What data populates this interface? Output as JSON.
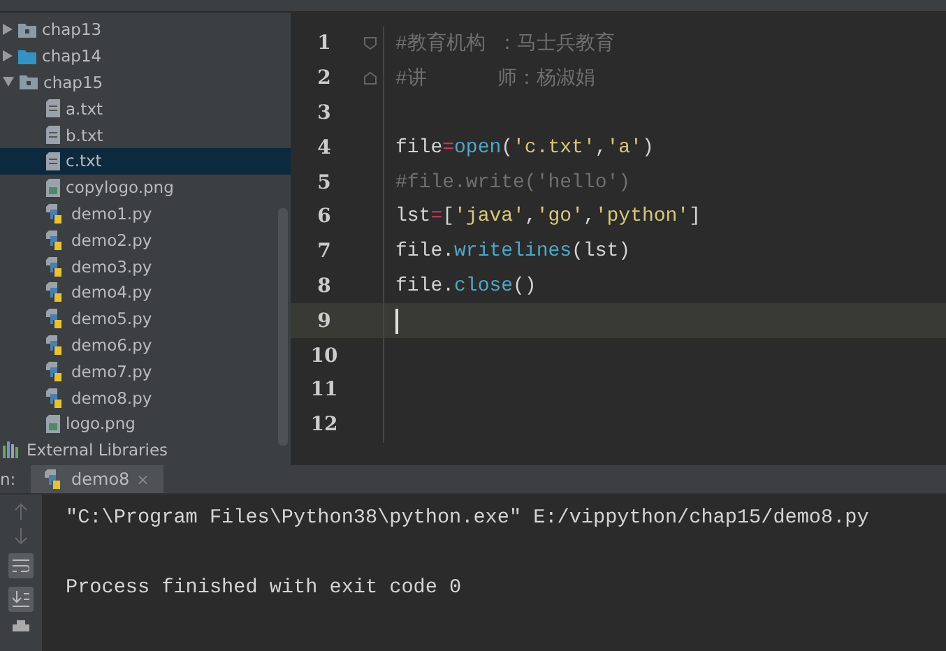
{
  "tree": [
    {
      "kind": "folder",
      "label": "chap13",
      "expanded": false,
      "selected": false
    },
    {
      "kind": "folder-blue",
      "label": "chap14",
      "expanded": false,
      "selected": false
    },
    {
      "kind": "folder",
      "label": "chap15",
      "expanded": true,
      "selected": false,
      "children": [
        {
          "kind": "txt",
          "label": "a.txt",
          "selected": false
        },
        {
          "kind": "txt",
          "label": "b.txt",
          "selected": false
        },
        {
          "kind": "txt",
          "label": "c.txt",
          "selected": true
        },
        {
          "kind": "image",
          "label": "copylogo.png",
          "selected": false
        },
        {
          "kind": "py",
          "label": "demo1.py",
          "selected": false
        },
        {
          "kind": "py",
          "label": "demo2.py",
          "selected": false
        },
        {
          "kind": "py",
          "label": "demo3.py",
          "selected": false
        },
        {
          "kind": "py",
          "label": "demo4.py",
          "selected": false
        },
        {
          "kind": "py",
          "label": "demo5.py",
          "selected": false
        },
        {
          "kind": "py",
          "label": "demo6.py",
          "selected": false
        },
        {
          "kind": "py",
          "label": "demo7.py",
          "selected": false
        },
        {
          "kind": "py",
          "label": "demo8.py",
          "selected": false
        },
        {
          "kind": "image",
          "label": "logo.png",
          "selected": false
        }
      ]
    },
    {
      "kind": "library",
      "label": "External Libraries",
      "selected": false
    }
  ],
  "editor": {
    "lines": [
      {
        "number": "1",
        "current": false,
        "fold_start": true,
        "tokens": [
          {
            "kind": "comment",
            "text": "#教育机构 ：马士兵教育"
          }
        ]
      },
      {
        "number": "2",
        "current": false,
        "fold_start": false,
        "tokens": [
          {
            "kind": "comment",
            "text": "#讲      师：杨淑娟"
          }
        ]
      },
      {
        "number": "3",
        "current": false
      },
      {
        "number": "4",
        "current": false,
        "tokens": [
          {
            "kind": "plain",
            "text": "file"
          },
          {
            "kind": "operator",
            "text": "="
          },
          {
            "kind": "call",
            "text": "open"
          },
          {
            "kind": "plain",
            "text": "("
          },
          {
            "kind": "string",
            "text": "'c.txt'"
          },
          {
            "kind": "plain",
            "text": ","
          },
          {
            "kind": "string",
            "text": "'a'"
          },
          {
            "kind": "plain",
            "text": ")"
          }
        ]
      },
      {
        "number": "5",
        "current": false,
        "tokens": [
          {
            "kind": "comment",
            "text": "#file.write('hello')"
          }
        ]
      },
      {
        "number": "6",
        "current": false,
        "tokens": [
          {
            "kind": "plain",
            "text": "lst"
          },
          {
            "kind": "operator",
            "text": "="
          },
          {
            "kind": "plain",
            "text": "["
          },
          {
            "kind": "string",
            "text": "'java'"
          },
          {
            "kind": "plain",
            "text": ","
          },
          {
            "kind": "string",
            "text": "'go'"
          },
          {
            "kind": "plain",
            "text": ","
          },
          {
            "kind": "string",
            "text": "'python'"
          },
          {
            "kind": "plain",
            "text": "]"
          }
        ]
      },
      {
        "number": "7",
        "current": false,
        "tokens": [
          {
            "kind": "plain",
            "text": "file."
          },
          {
            "kind": "call",
            "text": "writelines"
          },
          {
            "kind": "plain",
            "text": "(lst)"
          }
        ]
      },
      {
        "number": "8",
        "current": false,
        "tokens": [
          {
            "kind": "plain",
            "text": "file."
          },
          {
            "kind": "call",
            "text": "close"
          },
          {
            "kind": "plain",
            "text": "()"
          }
        ]
      },
      {
        "number": "9",
        "current": true
      },
      {
        "number": "10",
        "current": false
      },
      {
        "number": "11",
        "current": false
      },
      {
        "number": "12",
        "current": false
      }
    ]
  },
  "run": {
    "label": "n:",
    "tab": {
      "label": "demo8",
      "close": "×",
      "selected": true
    },
    "output": [
      "\"C:\\Program Files\\Python38\\python.exe\" E:/vippython/chap15/demo8.py",
      "Process finished with exit code 0"
    ]
  }
}
